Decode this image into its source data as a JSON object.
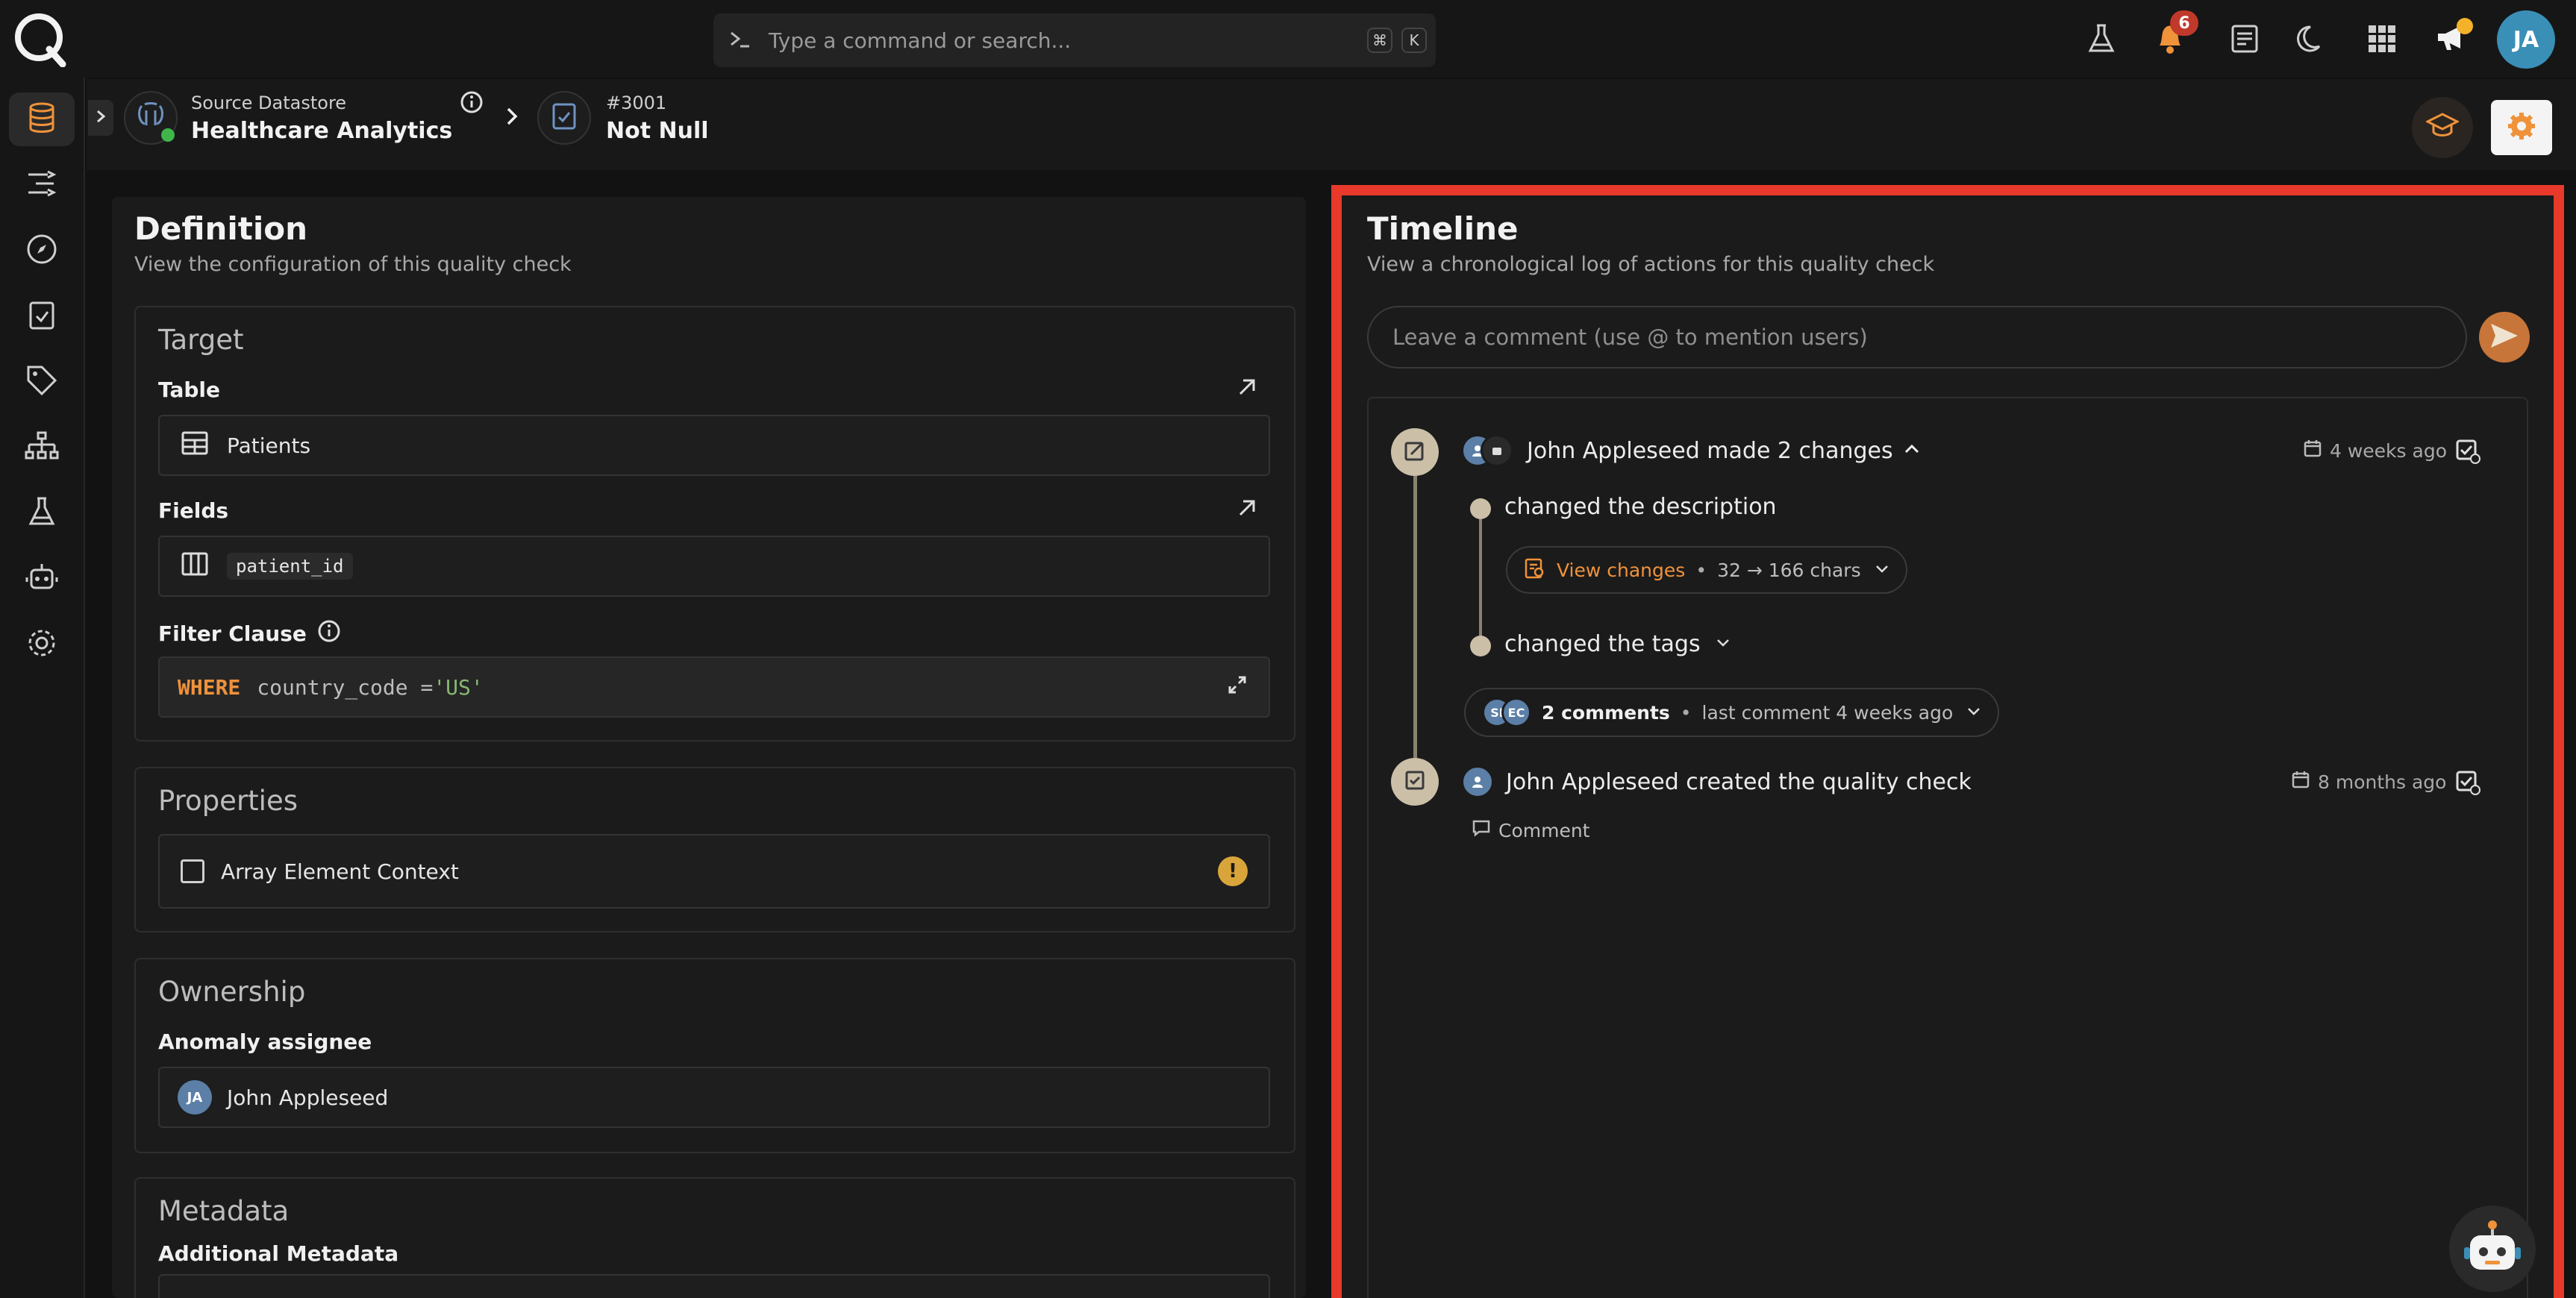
{
  "search": {
    "placeholder": "Type a command or search...",
    "kbd1": "⌘",
    "kbd2": "K"
  },
  "notifications": {
    "count": "6"
  },
  "user": {
    "initials": "JA"
  },
  "breadcrumb": {
    "datastore_label": "Source Datastore",
    "datastore_name": "Healthcare Analytics",
    "check_id": "#3001",
    "check_name": "Not Null"
  },
  "definition": {
    "title": "Definition",
    "subtitle": "View the configuration of this quality check",
    "target": {
      "title": "Target",
      "table_label": "Table",
      "table_value": "Patients",
      "fields_label": "Fields",
      "field_chip": "patient_id",
      "filter_label": "Filter Clause",
      "where": "WHERE",
      "filter_expr": "country_code = ",
      "filter_value": "'US'"
    },
    "properties": {
      "title": "Properties",
      "array_context": "Array Element Context"
    },
    "ownership": {
      "title": "Ownership",
      "assignee_label": "Anomaly assignee",
      "assignee_initials": "JA",
      "assignee_name": "John Appleseed"
    },
    "metadata": {
      "title": "Metadata",
      "additional_label": "Additional Metadata"
    }
  },
  "timeline": {
    "title": "Timeline",
    "subtitle": "View a chronological log of actions for this quality check",
    "comment_placeholder": "Leave a comment (use @ to mention users)",
    "entries": [
      {
        "actor_text": "John Appleseed made 2 changes",
        "time": "4 weeks ago",
        "change1": "changed the description",
        "view_changes": "View changes",
        "chars": "32 → 166 chars",
        "change2": "changed the tags",
        "avatar2": "SI",
        "avatar3": "EC",
        "comments": "2 comments",
        "last_comment": "last comment 4 weeks ago"
      },
      {
        "actor_text": "John Appleseed created the quality check",
        "time": "8 months ago",
        "comment_btn": "Comment"
      }
    ]
  },
  "colors": {
    "accent": "#f0923a",
    "highlight": "#e8392a",
    "avatar": "#3a8fb7"
  }
}
